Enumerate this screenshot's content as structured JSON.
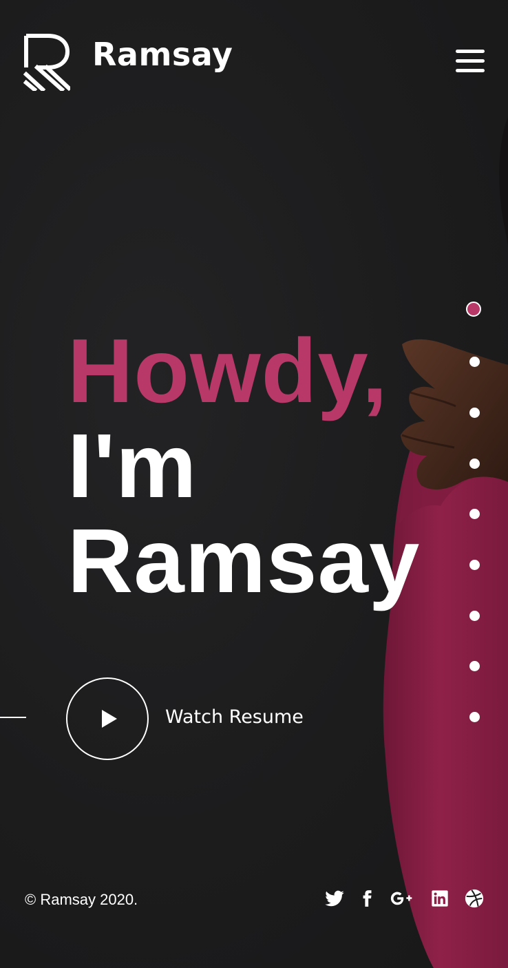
{
  "brand": {
    "name": "Ramsay",
    "logo_icon": "ramsay-r-logo-icon"
  },
  "header": {
    "menu_icon": "hamburger-menu-icon"
  },
  "hero": {
    "greeting": "Howdy,",
    "line2": "I'm",
    "line3": "Ramsay"
  },
  "cta": {
    "label": "Watch Resume",
    "play_icon": "play-icon"
  },
  "section_nav": {
    "count": 9,
    "active_index": 0
  },
  "footer": {
    "copyright": "© Ramsay 2020.",
    "socials": [
      "twitter-icon",
      "facebook-icon",
      "google-plus-icon",
      "linkedin-icon",
      "dribbble-icon"
    ]
  },
  "colors": {
    "accent": "#b83868",
    "background": "#1c1c1d",
    "text": "#ffffff",
    "sweater": "#8a1f45"
  }
}
